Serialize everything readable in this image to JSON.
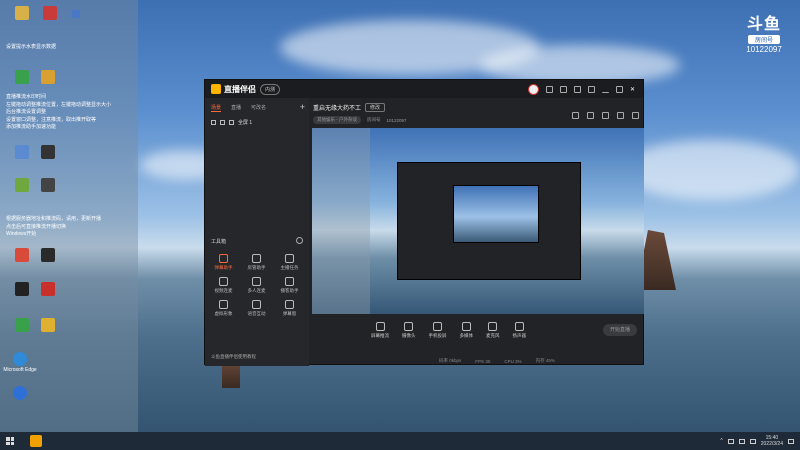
{
  "desktop": {
    "top_icons": [
      {
        "label": "",
        "color": "#d8b04a"
      },
      {
        "label": "",
        "color": "#c93a3a"
      },
      {
        "label": "",
        "color": "#4a78c9"
      }
    ],
    "notice_line1": "设置提示水表显示数据",
    "notice_block": [
      "直播推流水印时间",
      "左键拖动调整推流位置，左键拖动调整显示大小",
      "后台推流设置调整",
      "设置窗口调整，注意推流，取出推开取等",
      "添加推流助手加速功能"
    ],
    "notice_block2": [
      "根据服务器地址和推流码，请用，更新开播",
      "点击后可直接推流开播切换",
      "Windows开始"
    ],
    "icons": [
      {
        "name": "microsoft-edge",
        "label": "Microsoft Edge",
        "color": "#2f8ad8"
      },
      {
        "name": "app-blue",
        "label": "",
        "color": "#2f6fd8"
      },
      {
        "name": "app-green",
        "label": "",
        "color": "#39a04b"
      },
      {
        "name": "qq",
        "label": "",
        "color": "#222"
      }
    ],
    "douyu": {
      "logo": "斗鱼",
      "sub": "房间号",
      "room": "10122097"
    }
  },
  "app": {
    "title": "直播伴侣",
    "version": "内测",
    "sidebar_tabs": [
      "场景",
      "直播",
      "可改名"
    ],
    "scene_label": "全屏 1",
    "toolbox_title": "工具箱",
    "tools": [
      "弹幕助手",
      "房管助手",
      "主播任务",
      "视频连麦",
      "多人连麦",
      "播客助手",
      "虚拟形象",
      "语音互动",
      "弹幕窗"
    ],
    "bottom_tools": [
      "屏幕推流",
      "摄像头",
      "手机投屏",
      "多媒体",
      "麦克风",
      "扬声器"
    ],
    "announcement": "斗鱼直播伴侣使用教程",
    "room_title": "重启无缘大药不工",
    "room_btn": "修改",
    "category": "其他娱乐 - 户外杂谈",
    "room_label": "房间号",
    "room_number": "10122097",
    "start_button": "开始直播",
    "status": [
      "码率",
      "FPS",
      "CPU",
      "内存"
    ],
    "status_values": [
      "0kbps",
      "30",
      "3%",
      "45%"
    ]
  },
  "taskbar": {
    "time": "15:40",
    "date": "2022/3/24"
  }
}
